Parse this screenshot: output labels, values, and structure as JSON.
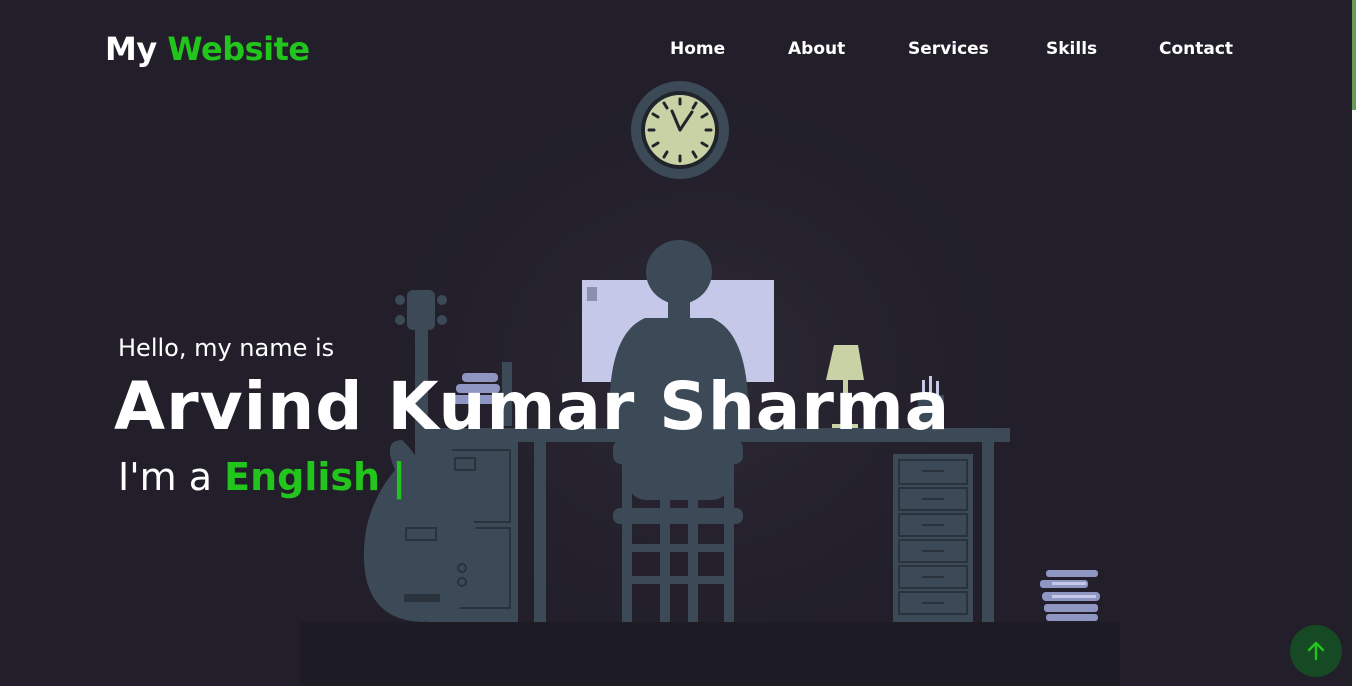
{
  "brand": {
    "prefix": "My",
    "accent": "Website",
    "accent_color": "#22c51b"
  },
  "nav": {
    "items": [
      {
        "label": "Home"
      },
      {
        "label": "About"
      },
      {
        "label": "Services"
      },
      {
        "label": "Skills"
      },
      {
        "label": "Contact"
      }
    ]
  },
  "hero": {
    "greeting": "Hello, my name is",
    "name": "Arvind Kumar Sharma",
    "role_prefix": "I'm a",
    "role_word": "English",
    "cursor": "|"
  },
  "controls": {
    "scroll_top_icon": "arrow-up-icon"
  },
  "colors": {
    "background": "#221f2a",
    "accent": "#22c51b",
    "scroll_button": "#154a25",
    "illustration": "#3c4a58"
  }
}
